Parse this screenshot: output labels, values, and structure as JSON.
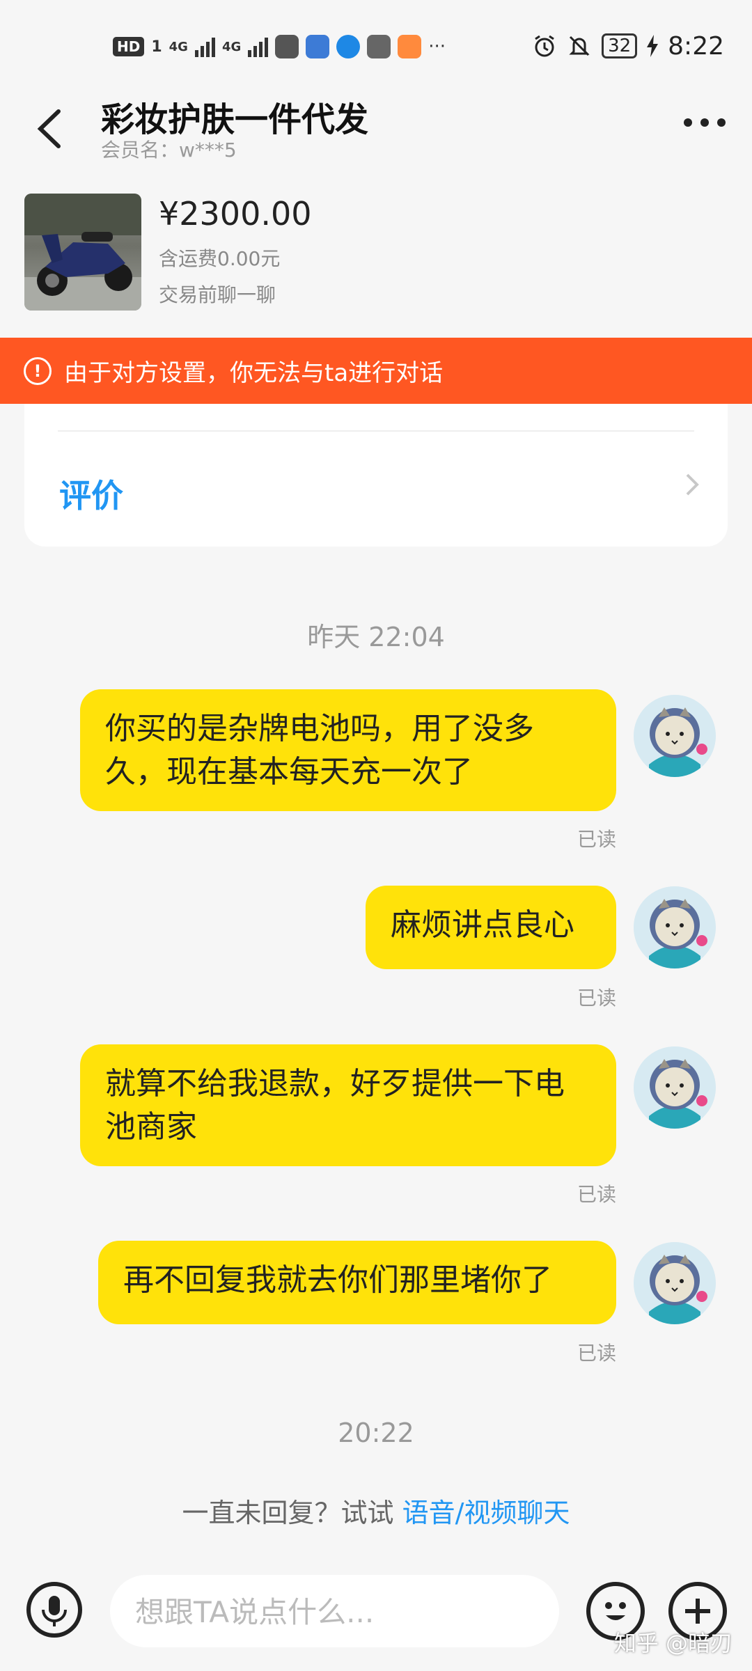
{
  "status_bar": {
    "hd": "HD",
    "sim": "1",
    "net1": "4G",
    "net2": "4G",
    "battery": "32",
    "time": "8:22",
    "more": "···"
  },
  "header": {
    "title": "彩妆护肤一件代发",
    "member": "会员名：w***5"
  },
  "product": {
    "price": "¥2300.00",
    "shipping": "含运费0.00元",
    "note": "交易前聊一聊"
  },
  "banner": {
    "text": "由于对方设置，你无法与ta进行对话"
  },
  "card": {
    "label": "评价"
  },
  "timestamps": [
    "昨天 22:04",
    "20:22"
  ],
  "messages": [
    {
      "text": "你买的是杂牌电池吗，用了没多久，现在基本每天充一次了",
      "status": "已读"
    },
    {
      "text": "麻烦讲点良心",
      "status": "已读"
    },
    {
      "text": "就算不给我退款，好歹提供一下电池商家",
      "status": "已读"
    },
    {
      "text": "再不回复我就去你们那里堵你了",
      "status": "已读"
    }
  ],
  "hint": {
    "prefix": "一直未回复？试试 ",
    "link": "语音/视频聊天"
  },
  "input": {
    "placeholder": "想跟TA说点什么..."
  },
  "watermark": "知乎 @暗刃",
  "colors": {
    "bubble": "#ffe20a",
    "banner": "#ff5722",
    "link": "#2196f3",
    "background": "#f6f6f6"
  },
  "icons": [
    "back-arrow-icon",
    "more-dots-icon",
    "warning-icon",
    "chevron-right-icon",
    "microphone-icon",
    "emoji-icon",
    "plus-icon",
    "alarm-icon",
    "mute-icon",
    "charging-icon"
  ]
}
